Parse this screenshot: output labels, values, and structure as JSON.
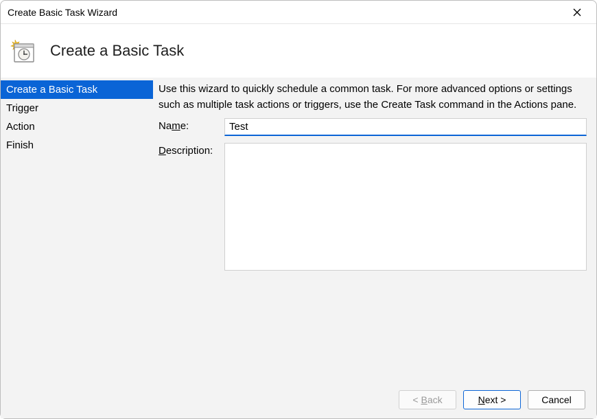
{
  "window": {
    "title": "Create Basic Task Wizard"
  },
  "header": {
    "heading": "Create a Basic Task"
  },
  "sidebar": {
    "steps": [
      {
        "label": "Create a Basic Task",
        "active": true
      },
      {
        "label": "Trigger",
        "active": false
      },
      {
        "label": "Action",
        "active": false
      },
      {
        "label": "Finish",
        "active": false
      }
    ]
  },
  "main": {
    "intro": "Use this wizard to quickly schedule a common task.  For more advanced options or settings such as multiple task actions or triggers, use the Create Task command in the Actions pane.",
    "name_label_pre": "Na",
    "name_label_u": "m",
    "name_label_post": "e:",
    "name_value": "Test",
    "desc_label_u": "D",
    "desc_label_post": "escription:",
    "desc_value": ""
  },
  "footer": {
    "back_pre": "< ",
    "back_u": "B",
    "back_post": "ack",
    "next_u": "N",
    "next_post": "ext >",
    "cancel": "Cancel"
  },
  "icons": {
    "close": "close-icon",
    "wizard": "scheduled-task-wizard-icon"
  },
  "colors": {
    "accent": "#0a64d6",
    "panel": "#f3f3f3"
  }
}
